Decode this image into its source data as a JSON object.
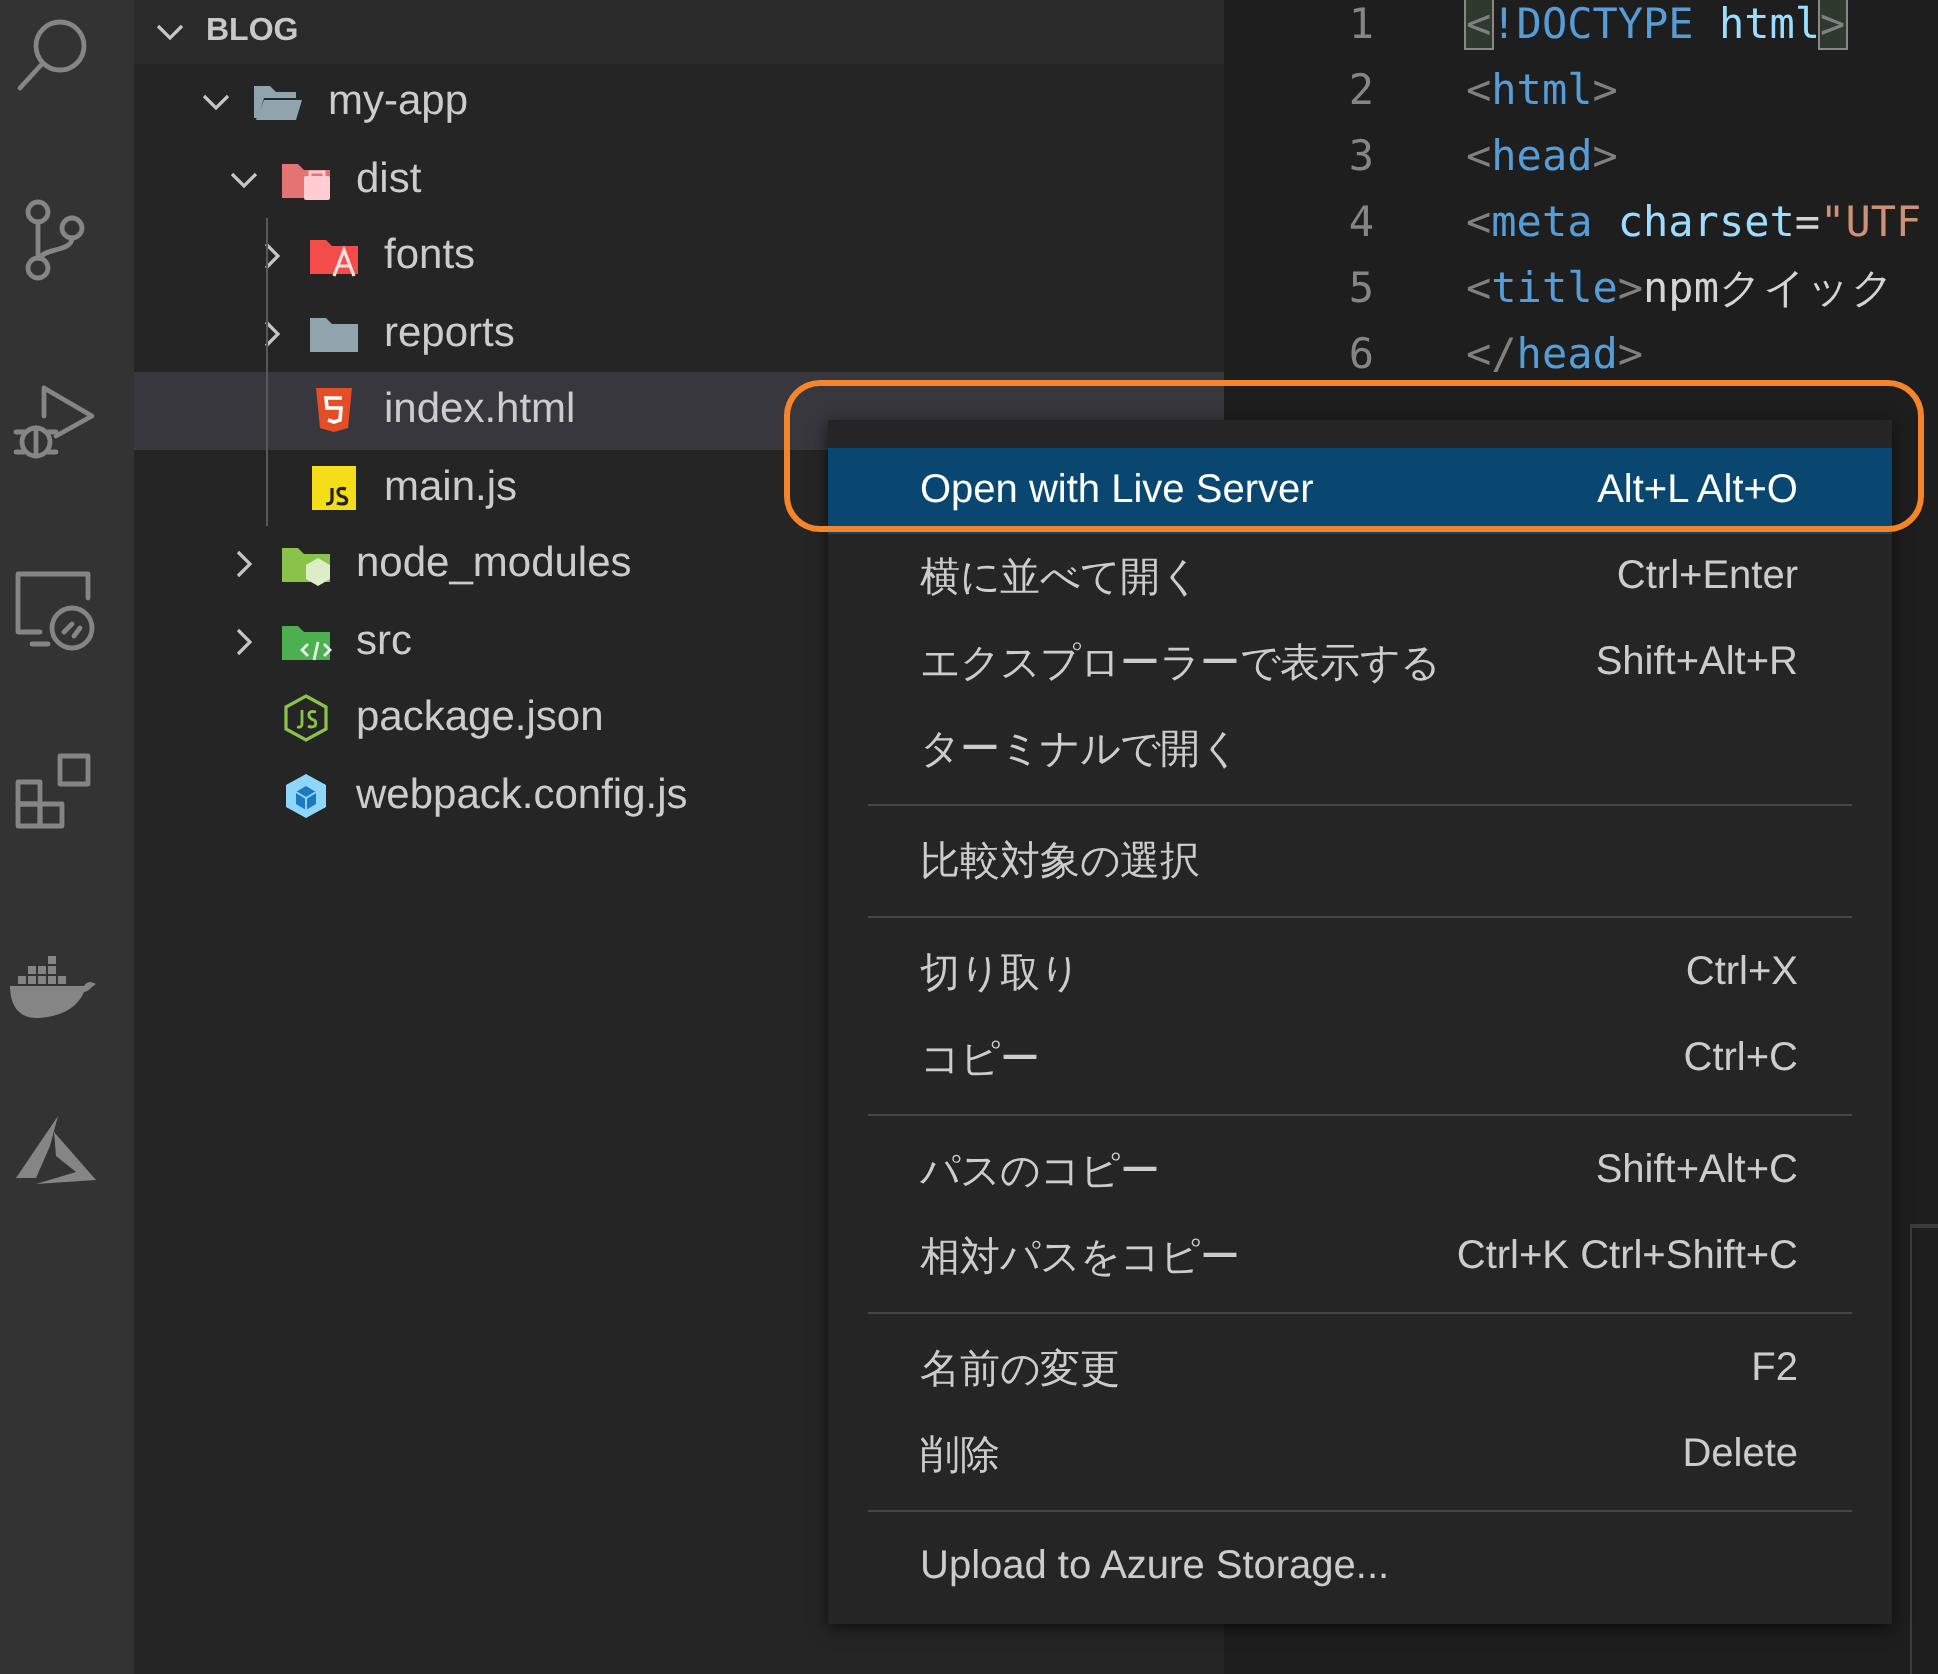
{
  "activity_bar": {
    "items": [
      {
        "kind": "search",
        "selected": false
      },
      {
        "kind": "source-control",
        "selected": false
      },
      {
        "kind": "run-debug",
        "selected": false
      },
      {
        "kind": "remote",
        "selected": false
      },
      {
        "kind": "extensions",
        "selected": false
      },
      {
        "kind": "docker",
        "selected": false
      },
      {
        "kind": "azure",
        "selected": false
      }
    ]
  },
  "explorer": {
    "section": {
      "title": "BLOG",
      "expanded": true
    },
    "tree": [
      {
        "label": "my-app",
        "kind": "folder",
        "expanded": true,
        "selected": false,
        "children": [
          {
            "label": "dist",
            "kind": "folder-dist",
            "expanded": true,
            "selected": false,
            "children": [
              {
                "label": "fonts",
                "kind": "folder-font",
                "expanded": false,
                "selected": false
              },
              {
                "label": "reports",
                "kind": "folder",
                "expanded": false,
                "selected": false
              },
              {
                "label": "index.html",
                "kind": "html",
                "selected": true
              },
              {
                "label": "main.js",
                "kind": "js",
                "selected": false
              }
            ]
          },
          {
            "label": "node_modules",
            "kind": "folder-node",
            "expanded": false,
            "selected": false
          },
          {
            "label": "src",
            "kind": "folder-src",
            "expanded": false,
            "selected": false
          },
          {
            "label": "package.json",
            "kind": "npm",
            "selected": false
          },
          {
            "label": "webpack.config.js",
            "kind": "webpack",
            "selected": false
          }
        ]
      }
    ]
  },
  "editor": {
    "lines": [
      {
        "number": "1",
        "tokens": [
          {
            "kind": "matched",
            "text": "<"
          },
          {
            "kind": "tag",
            "text": "!DOCTYPE"
          },
          {
            "kind": "attr",
            "text": " html"
          },
          {
            "kind": "matched",
            "text": ">"
          }
        ]
      },
      {
        "number": "2",
        "tokens": [
          {
            "kind": "punct",
            "text": "<"
          },
          {
            "kind": "tag",
            "text": "html"
          },
          {
            "kind": "punct",
            "text": ">"
          }
        ]
      },
      {
        "number": "3",
        "tokens": [
          {
            "kind": "punct",
            "text": "<"
          },
          {
            "kind": "tag",
            "text": "head"
          },
          {
            "kind": "punct",
            "text": ">"
          }
        ]
      },
      {
        "number": "4",
        "tokens": [
          {
            "kind": "punct",
            "text": "<"
          },
          {
            "kind": "tag",
            "text": "meta"
          },
          {
            "kind": "attr",
            "text": " charset"
          },
          {
            "kind": "text",
            "text": "="
          },
          {
            "kind": "string",
            "text": "\"UTF"
          }
        ]
      },
      {
        "number": "5",
        "tokens": [
          {
            "kind": "punct",
            "text": "<"
          },
          {
            "kind": "tag",
            "text": "title"
          },
          {
            "kind": "punct",
            "text": ">"
          },
          {
            "kind": "text",
            "text": "npmクイック"
          }
        ]
      },
      {
        "number": "6",
        "tokens": [
          {
            "kind": "punct",
            "text": "</"
          },
          {
            "kind": "tag",
            "text": "head"
          },
          {
            "kind": "punct",
            "text": ">"
          }
        ]
      }
    ]
  },
  "context_menu": {
    "groups": [
      [
        {
          "label": "Open with Live Server",
          "shortcut": "Alt+L Alt+O",
          "selected": true
        },
        {
          "label": "横に並べて開く",
          "shortcut": "Ctrl+Enter",
          "selected": false
        },
        {
          "label": "エクスプローラーで表示する",
          "shortcut": "Shift+Alt+R",
          "selected": false
        },
        {
          "label": "ターミナルで開く",
          "selected": false
        }
      ],
      [
        {
          "label": "比較対象の選択",
          "selected": false
        }
      ],
      [
        {
          "label": "切り取り",
          "shortcut": "Ctrl+X",
          "selected": false
        },
        {
          "label": "コピー",
          "shortcut": "Ctrl+C",
          "selected": false
        }
      ],
      [
        {
          "label": "パスのコピー",
          "shortcut": "Shift+Alt+C",
          "selected": false
        },
        {
          "label": "相対パスをコピー",
          "shortcut": "Ctrl+K Ctrl+Shift+C",
          "selected": false
        }
      ],
      [
        {
          "label": "名前の変更",
          "shortcut": "F2",
          "selected": false
        },
        {
          "label": "削除",
          "shortcut": "Delete",
          "selected": false
        }
      ],
      [
        {
          "label": "Upload to Azure Storage...",
          "selected": false
        }
      ]
    ]
  }
}
